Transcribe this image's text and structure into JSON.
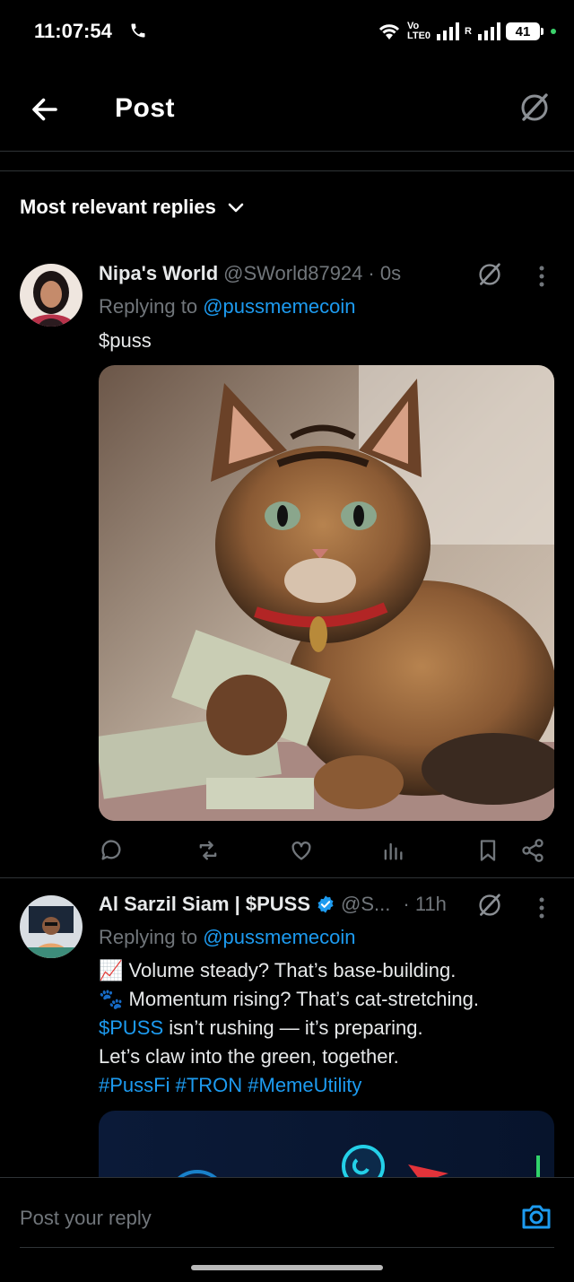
{
  "status_bar": {
    "time": "11:07:54",
    "network_top": "Vo",
    "network_bottom": "LTE0",
    "roaming": "R",
    "battery": "41"
  },
  "header": {
    "title": "Post"
  },
  "sort": {
    "label": "Most relevant replies"
  },
  "posts": [
    {
      "display_name": "Nipa's World",
      "handle": "@SWorld87924",
      "time": "· 0s",
      "replying_prefix": "Replying to",
      "replying_to": "@pussmemecoin",
      "text": "$puss"
    },
    {
      "display_name": "Al Sarzil Siam | $PUSS",
      "handle": "@S...",
      "time": "· 11h",
      "replying_prefix": "Replying to",
      "replying_to": "@pussmemecoin",
      "lines": {
        "l1": "📈 Volume steady? That’s base-building.",
        "l2": "🐾 Momentum rising? That’s cat-stretching.",
        "l3_tag": "$PUSS",
        "l3_rest": " isn’t rushing — it’s preparing.",
        "l4": "Let’s claw into the green, together.",
        "hashtags": "#PussFi #TRON #MemeUtility"
      }
    }
  ],
  "reply_bar": {
    "placeholder": "Post your reply"
  },
  "colors": {
    "background": "#000000",
    "link": "#1d9bf0",
    "muted": "#71767b",
    "divider": "#2f3336"
  }
}
